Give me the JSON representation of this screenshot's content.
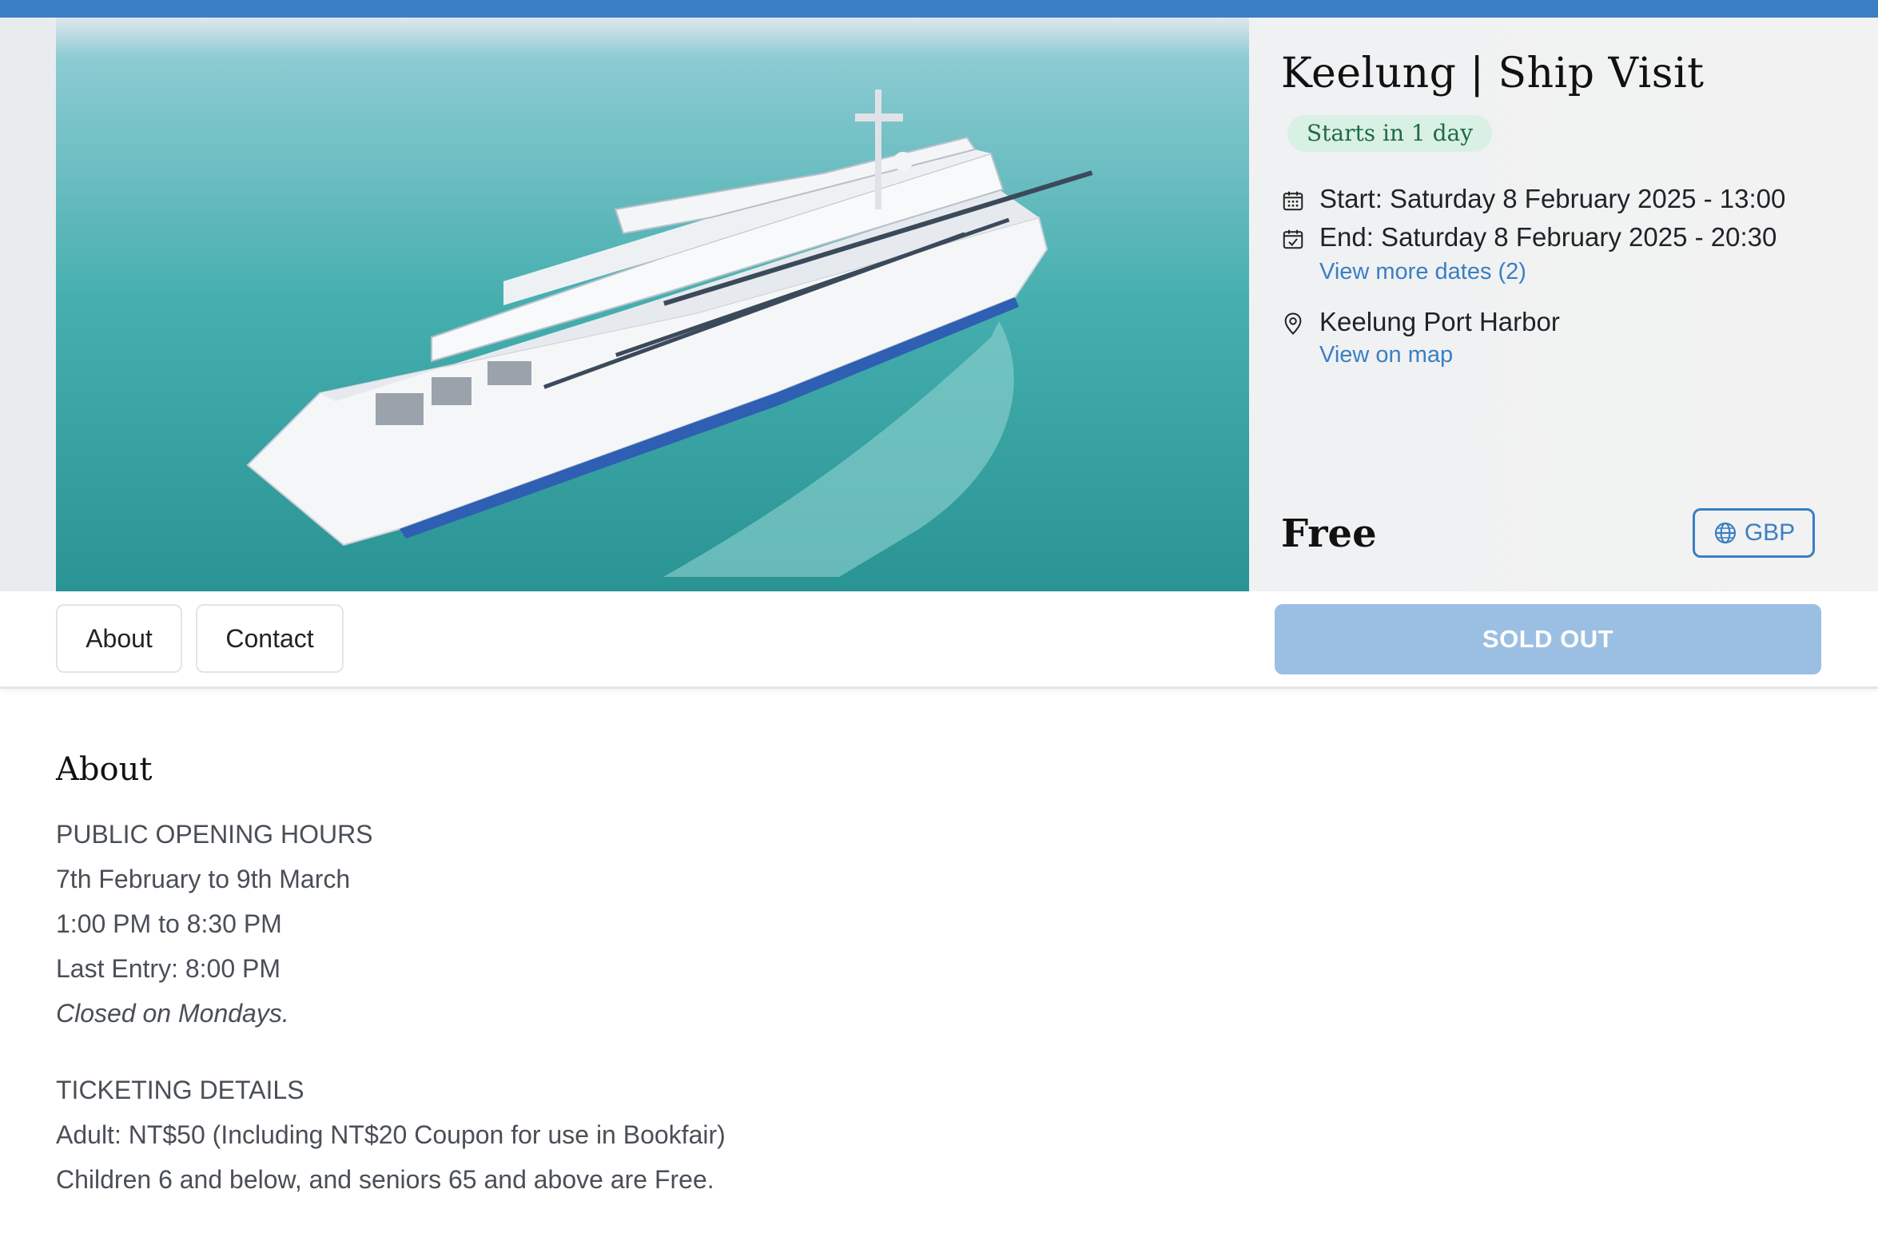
{
  "event": {
    "title": "Keelung | Ship Visit",
    "status_badge": "Starts in 1 day",
    "start": "Start: Saturday 8 February 2025 - 13:00",
    "end": "End: Saturday 8 February 2025 - 20:30",
    "more_dates_link": "View more dates (2)",
    "location": "Keelung Port Harbor",
    "map_link": "View on map",
    "price": "Free",
    "currency": "GBP"
  },
  "icons": {
    "calendar": "calendar-icon",
    "calendar_check": "calendar-check-icon",
    "location": "map-pin-icon",
    "globe": "globe-icon"
  },
  "nav": {
    "tabs": [
      "About",
      "Contact"
    ],
    "sold_out": "SOLD OUT"
  },
  "about": {
    "heading": "About",
    "opening_hours": {
      "heading": "PUBLIC OPENING HOURS",
      "lines": [
        "7th February to 9th March",
        "1:00 PM to 8:30 PM",
        "Last Entry: 8:00 PM"
      ],
      "note": "Closed on Mondays."
    },
    "ticketing": {
      "heading": "TICKETING DETAILS",
      "lines": [
        "Adult: NT$50 (Including NT$20 Coupon for use in Bookfair)",
        "Children 6 and below, and seniors 65 and above are Free."
      ]
    }
  },
  "colors": {
    "accent": "#3a7fc4",
    "badge_bg": "#d9f0e4",
    "badge_text": "#1f6b45",
    "sold_out_bg": "#9bbfe2"
  }
}
